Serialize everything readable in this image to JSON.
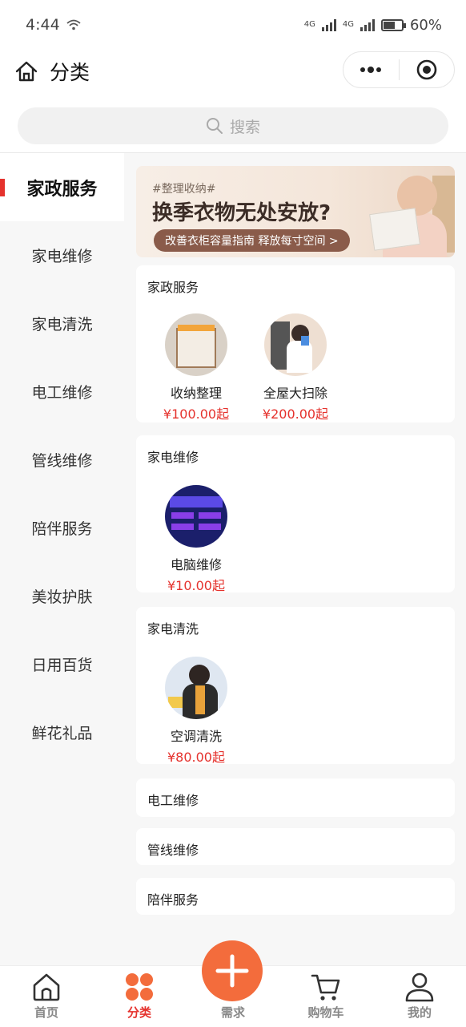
{
  "status": {
    "time": "4:44",
    "net1": "4G",
    "net2": "4G",
    "battery": "60%",
    "battery_level": 0.6
  },
  "nav": {
    "title": "分类"
  },
  "search": {
    "placeholder": "搜索"
  },
  "sidebar": {
    "items": [
      {
        "label": "家政服务",
        "active": true
      },
      {
        "label": "家电维修"
      },
      {
        "label": "家电清洗"
      },
      {
        "label": "电工维修"
      },
      {
        "label": "管线维修"
      },
      {
        "label": "陪伴服务"
      },
      {
        "label": "美妆护肤"
      },
      {
        "label": "日用百货"
      },
      {
        "label": "鲜花礼品"
      }
    ]
  },
  "banner": {
    "tag": "#整理收纳#",
    "headline": "换季衣物无处安放?",
    "button": "改善衣柜容量指南 释放每寸空间 >"
  },
  "sections": [
    {
      "title": "家政服务",
      "products": [
        {
          "name": "收纳整理",
          "price": "¥100.00起"
        },
        {
          "name": "全屋大扫除",
          "price": "¥200.00起"
        }
      ]
    },
    {
      "title": "家电维修",
      "products": [
        {
          "name": "电脑维修",
          "price": "¥10.00起"
        }
      ]
    },
    {
      "title": "家电清洗",
      "products": [
        {
          "name": "空调清洗",
          "price": "¥80.00起"
        }
      ]
    },
    {
      "title": "电工维修",
      "products": []
    },
    {
      "title": "管线维修",
      "products": []
    },
    {
      "title": "陪伴服务",
      "products": []
    }
  ],
  "tabbar": {
    "home": "首页",
    "category": "分类",
    "demand": "需求",
    "cart": "购物车",
    "mine": "我的"
  },
  "colors": {
    "accent": "#e5322d",
    "plus": "#f36c3c"
  }
}
